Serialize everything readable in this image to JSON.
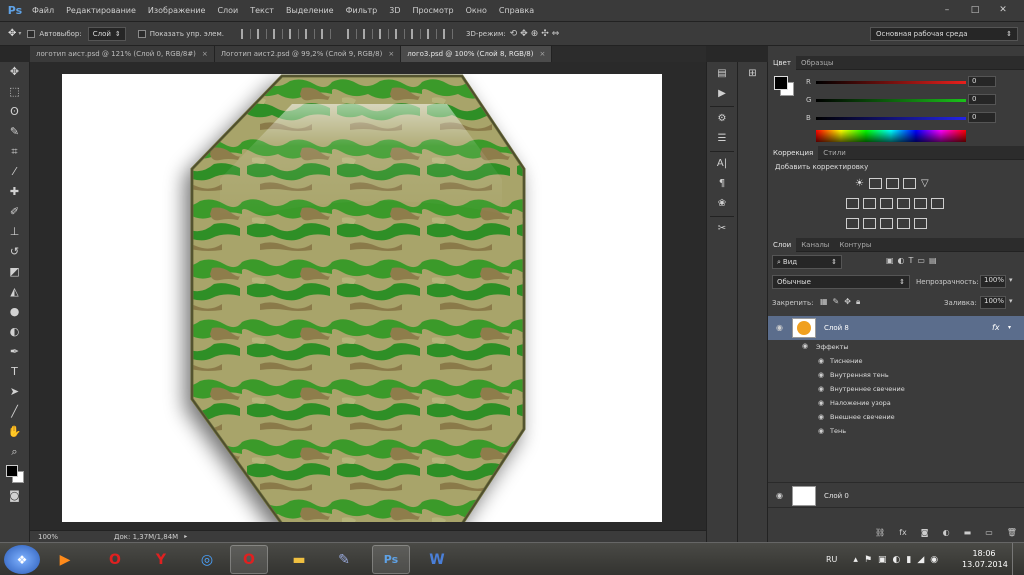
{
  "app": {
    "logo": "Ps"
  },
  "menu": [
    "Файл",
    "Редактирование",
    "Изображение",
    "Слои",
    "Текст",
    "Выделение",
    "Фильтр",
    "3D",
    "Просмотр",
    "Окно",
    "Справка"
  ],
  "window_controls": {
    "minimize": "–",
    "maximize": "□",
    "close": "✕"
  },
  "options": {
    "autoselect_label": "Автовыбор:",
    "autoselect_value": "Слой",
    "show_controls_label": "Показать упр. элем.",
    "mode_3d_label": "3D-режим:",
    "workspace": "Основная рабочая среда"
  },
  "tabs": [
    {
      "label": "логотип аист.psd @ 121% (Слой 0, RGB/8#)",
      "active": false
    },
    {
      "label": "Логотип аист2.psd @ 99,2% (Слой 9, RGB/8)",
      "active": false
    },
    {
      "label": "лого3.psd @ 100% (Слой 8, RGB/8)",
      "active": true
    }
  ],
  "tools": [
    "move-tool",
    "marquee-tool",
    "lasso-tool",
    "quick-select-tool",
    "crop-tool",
    "eyedropper-tool",
    "healing-brush-tool",
    "brush-tool",
    "clone-stamp-tool",
    "history-brush-tool",
    "eraser-tool",
    "paint-bucket-tool",
    "blur-tool",
    "dodge-tool",
    "pen-tool",
    "type-tool",
    "path-select-tool",
    "line-tool",
    "hand-tool",
    "zoom-tool"
  ],
  "status": {
    "zoom": "100%",
    "doc_info": "Док: 1,37М/1,84М"
  },
  "color_panel": {
    "tabs": [
      "Цвет",
      "Образцы"
    ],
    "sliders": [
      {
        "label": "R",
        "value": "0",
        "color": "#e8201c"
      },
      {
        "label": "G",
        "value": "0",
        "color": "#1ac31a"
      },
      {
        "label": "B",
        "value": "0",
        "color": "#2424e6"
      }
    ]
  },
  "adjustments_panel": {
    "tabs": [
      "Коррекция",
      "Стили"
    ],
    "title": "Добавить корректировку"
  },
  "layers_panel": {
    "tabs": [
      "Слои",
      "Каналы",
      "Контуры"
    ],
    "filter": "Вид",
    "blend_mode": "Обычные",
    "opacity_label": "Непрозрачность:",
    "opacity_value": "100%",
    "lock_label": "Закрепить:",
    "fill_label": "Заливка:",
    "fill_value": "100%",
    "layers": [
      {
        "name": "Слой 8",
        "fx": "fx",
        "selected": true,
        "thumb_color": "#f0a020"
      },
      {
        "name": "Слой 0",
        "fx": "",
        "selected": false,
        "thumb_color": "#ffffff"
      }
    ],
    "effects_label": "Эффекты",
    "effects": [
      "Тиснение",
      "Внутренняя тень",
      "Внутреннее свечение",
      "Наложение узора",
      "Внешнее свечение",
      "Тень"
    ]
  },
  "taskbar": {
    "language": "RU",
    "time": "18:06",
    "date": "13.07.2014"
  }
}
